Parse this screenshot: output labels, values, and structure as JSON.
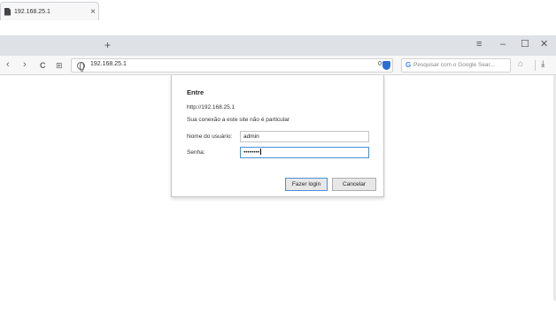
{
  "tab": {
    "title": "192.168.25.1",
    "close_icon": "×",
    "new_tab": "+"
  },
  "window_controls": {
    "menu": "≡",
    "minimize": "–",
    "maximize": "☐",
    "close": "✕"
  },
  "nav": {
    "back": "‹",
    "forward": "›",
    "reload": "C",
    "speed_dial": "⊞"
  },
  "address_bar": {
    "url": "192.168.25.1",
    "blocked_count": "0"
  },
  "search": {
    "placeholder": "Pesquisar com o Google Sear..."
  },
  "login_dialog": {
    "title": "Entre",
    "site": "http://192.168.25.1",
    "warning": "Sua conexão a este site não é particular",
    "username_label": "Nome do usuário:",
    "username_value": "admin",
    "password_label": "Senha:",
    "password_mask": "••••••••",
    "login_button": "Fazer login",
    "cancel_button": "Cancelar"
  },
  "colors": {
    "accent": "#4a90d9",
    "shield": "#2a6fd6",
    "google": "#4285f4"
  }
}
